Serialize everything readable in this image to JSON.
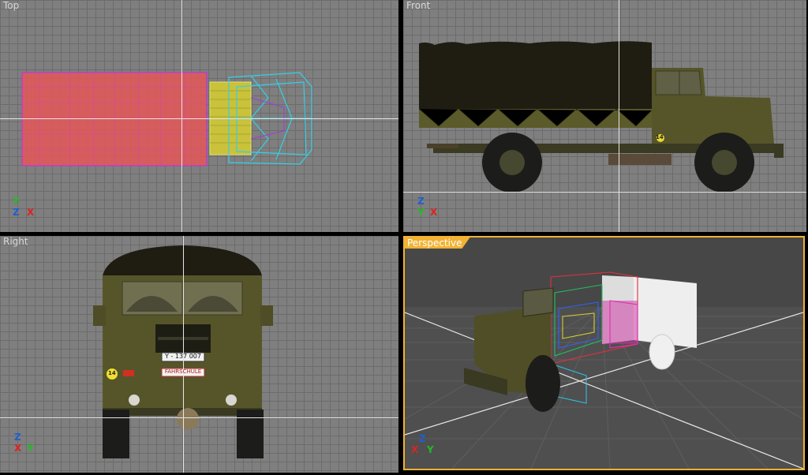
{
  "viewports": {
    "top": {
      "label": "Top",
      "triad": {
        "up": "Y",
        "a": "Z",
        "b": "X"
      }
    },
    "front": {
      "label": "Front",
      "triad": {
        "up": "Z",
        "a": "Y",
        "b": "X"
      }
    },
    "right": {
      "label": "Right",
      "triad": {
        "up": "Z",
        "a": "X",
        "b": "Y"
      }
    },
    "perspective": {
      "label": "Perspective",
      "active": true,
      "triad": {
        "up": "Z",
        "a": "X",
        "b": "Y"
      }
    }
  },
  "truck": {
    "plate": "Y - 137 007",
    "school_sign": "FAHRSCHULE",
    "badge": "14"
  },
  "colors": {
    "viewport_bg": "#7f7f7f",
    "grid": "#6c6c6c",
    "active_border": "#f2b233",
    "truck_olive": "#5b5a2a",
    "canvas_dark": "#1e1b10"
  }
}
